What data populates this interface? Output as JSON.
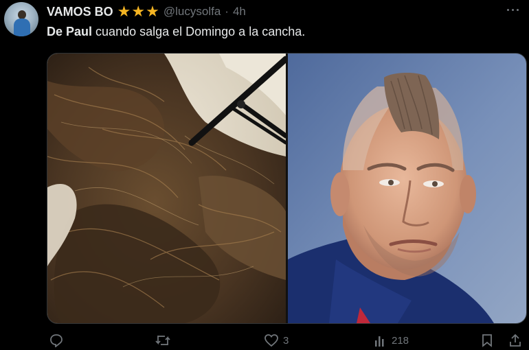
{
  "post": {
    "author_name": "VAMOS BO",
    "verified_badges": [
      "star",
      "star",
      "star"
    ],
    "handle": "@lucysolfa",
    "separator": "·",
    "time": "4h",
    "text_mention": "De Paul",
    "text_body": "cuando salga el Domingo a la cancha."
  },
  "media": {
    "left_image": "hair-on-floor-photo",
    "right_image": "mohawk-haircut-photo"
  },
  "actions": {
    "reply_count": "",
    "repost_count": "",
    "like_count": "3",
    "views_count": "218"
  },
  "colors": {
    "background": "#000000",
    "text_primary": "#e7e9ea",
    "text_secondary": "#71767b",
    "star": "#f5b523"
  }
}
